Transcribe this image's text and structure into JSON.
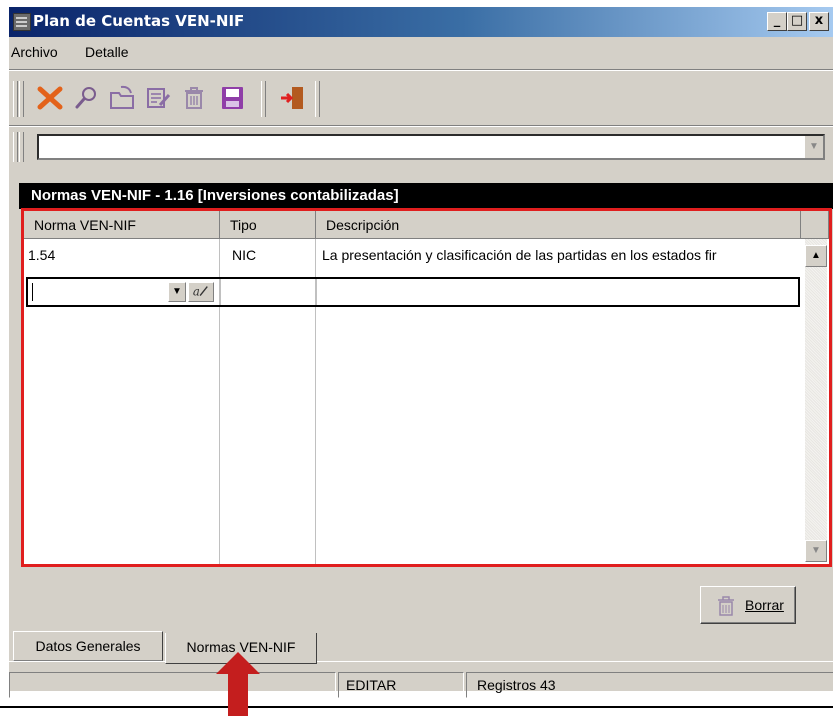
{
  "window": {
    "title": "Plan de Cuentas VEN-NIF",
    "controls": [
      "_",
      "□",
      "x"
    ]
  },
  "menu": {
    "items": [
      "Archivo",
      "Detalle"
    ]
  },
  "toolbar": {
    "icons": [
      "delete-x-icon",
      "search-icon",
      "open-folder-icon",
      "edit-icon",
      "trash-icon",
      "save-icon",
      "exit-door-icon"
    ]
  },
  "panel": {
    "header": "Normas VEN-NIF - 1.16 [Inversiones contabilizadas]",
    "columns": [
      "Norma VEN-NIF",
      "Tipo",
      "Descripción"
    ],
    "rows": [
      {
        "norma": "1.54",
        "tipo": "NIC",
        "descripcion": "La presentación y clasificación de las partidas en los estados fir"
      }
    ]
  },
  "buttons": {
    "borrar": "Borrar"
  },
  "tabs": [
    "Datos Generales",
    "Normas VEN-NIF"
  ],
  "status": {
    "mode": "EDITAR",
    "records": "Registros 43"
  },
  "colors": {
    "highlight_border": "#e01e1e",
    "title_gradient_start": "#0a246a",
    "arrow": "#c41e1e"
  }
}
